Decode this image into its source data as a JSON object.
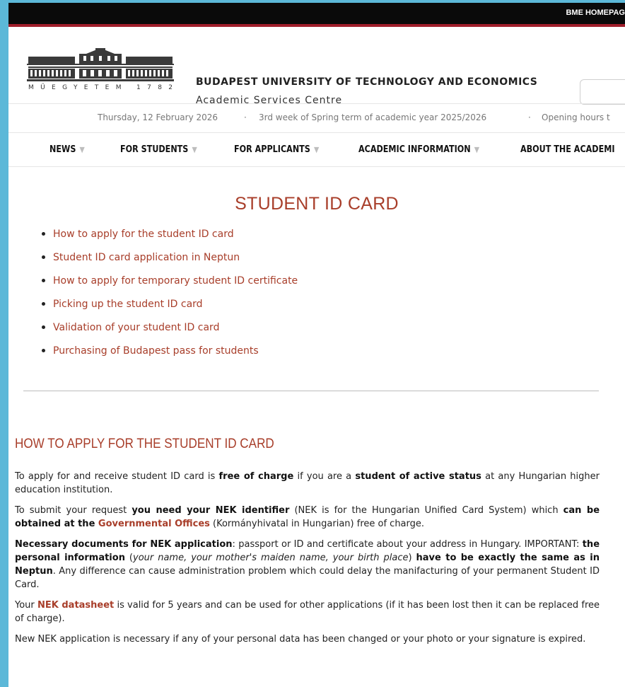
{
  "topbar": {
    "home_link": "BME HOMEPAG"
  },
  "header": {
    "university_name": "BUDAPEST UNIVERSITY OF TECHNOLOGY AND ECONOMICS",
    "centre_name": "Academic Services Centre",
    "logo_text": "MŰEGYETEM 1782",
    "search_placeholder": ""
  },
  "infobar": {
    "date": "Thursday, 12 February 2026",
    "sep1": "·",
    "term": "3rd week of Spring term of academic year 2025/2026",
    "sep2": "·",
    "hours": "Opening hours t"
  },
  "nav": {
    "items": [
      {
        "label": "NEWS",
        "caret": "chevron-down-icon"
      },
      {
        "label": "FOR STUDENTS",
        "caret": "chevron-down-icon"
      },
      {
        "label": "FOR APPLICANTS",
        "caret": "chevron-down-icon"
      },
      {
        "label": "ACADEMIC INFORMATION",
        "caret": "chevron-down-icon"
      },
      {
        "label": "ABOUT THE ACADEMI"
      }
    ]
  },
  "page": {
    "title": "STUDENT ID CARD"
  },
  "toc": [
    "How to apply for the student ID card",
    "Student ID card application in Neptun",
    "How to apply for temporary student ID certificate",
    "Picking up the student ID card",
    "Validation of your student ID card",
    "Purchasing of Budapest pass for students"
  ],
  "section": {
    "title": "HOW TO APPLY FOR THE STUDENT ID CARD",
    "p1": {
      "a": "To apply for and receive student ID card is ",
      "b": "free of charge",
      "c": " if you are a ",
      "d": "student of active status",
      "e": " at any Hungarian higher education institution."
    },
    "p2": {
      "a": "To submit your request ",
      "b": "you need your NEK identifier",
      "c": " (NEK is for the Hungarian Unified Card System) which ",
      "d": "can be obtained at the ",
      "link": "Governmental Offices",
      "e": " (Kormányhivatal in Hungarian) free of charge."
    },
    "p3": {
      "a": "Necessary documents for NEK application",
      "b": ": passport or ID and certificate about your address in Hungary. IMPORTANT: ",
      "c": "the personal information",
      "d": " (",
      "e": "your name, your mother's maiden name, your birth place",
      "f": ") ",
      "g": "have to be exactly the same as in Neptun",
      "h": ". Any difference can cause administration problem which could delay the manifacturing of your permanent Student ID Card."
    },
    "p4": {
      "a": "Your ",
      "link": "NEK datasheet",
      "b": " is valid for 5 years and can be used for other applications (if it has been lost then it can be replaced free of charge)."
    },
    "p5": "New NEK application is necessary if any of your personal data has been changed or your photo or your signature is expired."
  },
  "colors": {
    "accent": "#a83e2a",
    "topbar": "#0a0a0a",
    "topbar_border": "#a01e2a",
    "background": "#5cb8d8"
  }
}
